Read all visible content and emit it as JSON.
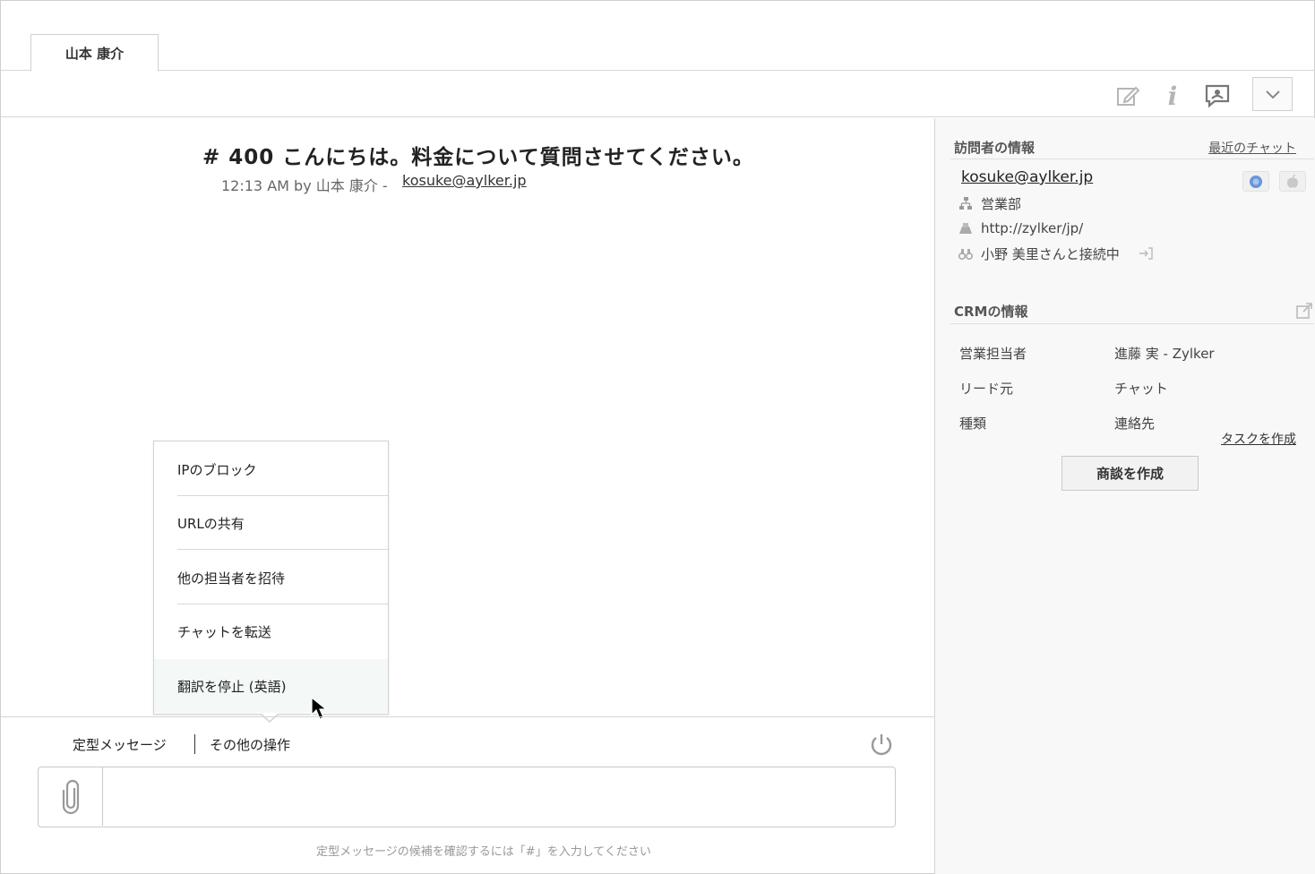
{
  "tab": {
    "label": "山本 康介"
  },
  "chat": {
    "title": "# 400 こんにちは。料金について質問させてください。",
    "meta": "12:13 AM by 山本 康介 -",
    "email": "kosuke@aylker.jp"
  },
  "menu": {
    "items": [
      {
        "label": "IPのブロック"
      },
      {
        "label": "URLの共有"
      },
      {
        "label": "他の担当者を招待"
      },
      {
        "label": "チャットを転送"
      },
      {
        "label": "翻訳を停止 (英語)"
      }
    ]
  },
  "composer": {
    "canned_label": "定型メッセージ",
    "more_label": "その他の操作",
    "hint": "定型メッセージの候補を確認するには「#」を入力してください",
    "input_value": ""
  },
  "visitor": {
    "section_title": "訪問者の情報",
    "recent_chats": "最近のチャット",
    "email": "kosuke@aylker.jp",
    "department": "営業部",
    "url": "http://zylker/jp/",
    "connected": "小野 美里さんと接続中"
  },
  "crm": {
    "section_title": "CRMの情報",
    "rows": [
      {
        "label": "営業担当者",
        "value": "進藤 実 - Zylker"
      },
      {
        "label": "リード元",
        "value": "チャット"
      },
      {
        "label": "種類",
        "value": "連絡先"
      }
    ],
    "create_task": "タスクを作成",
    "create_deal": "商談を作成"
  },
  "icons": {
    "toolbar": [
      "edit-icon",
      "info-icon",
      "chat-bubble-icon",
      "chevron-down-icon"
    ],
    "accent_gray": "#b5b5b5"
  }
}
